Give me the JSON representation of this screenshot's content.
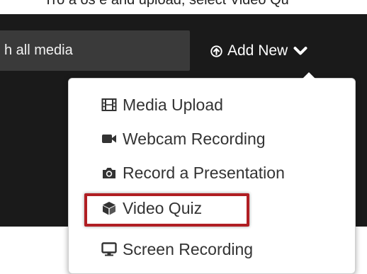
{
  "top_caption_fragment": "Tro a os e and upload, select Video Qu",
  "search": {
    "value": "h all media"
  },
  "header": {
    "add_new_label": "Add New"
  },
  "menu": {
    "items": [
      {
        "label": "Media Upload",
        "icon": "film-icon"
      },
      {
        "label": "Webcam Recording",
        "icon": "video-camera-icon"
      },
      {
        "label": "Record a Presentation",
        "icon": "camera-icon"
      },
      {
        "label": "Video Quiz",
        "icon": "cube-icon"
      },
      {
        "label": "Screen Recording",
        "icon": "desktop-icon"
      }
    ]
  },
  "colors": {
    "header_bg": "#1a1a1a",
    "search_bg": "#3a3a3a",
    "highlight_border": "#b01e23",
    "menu_text": "#333333"
  }
}
